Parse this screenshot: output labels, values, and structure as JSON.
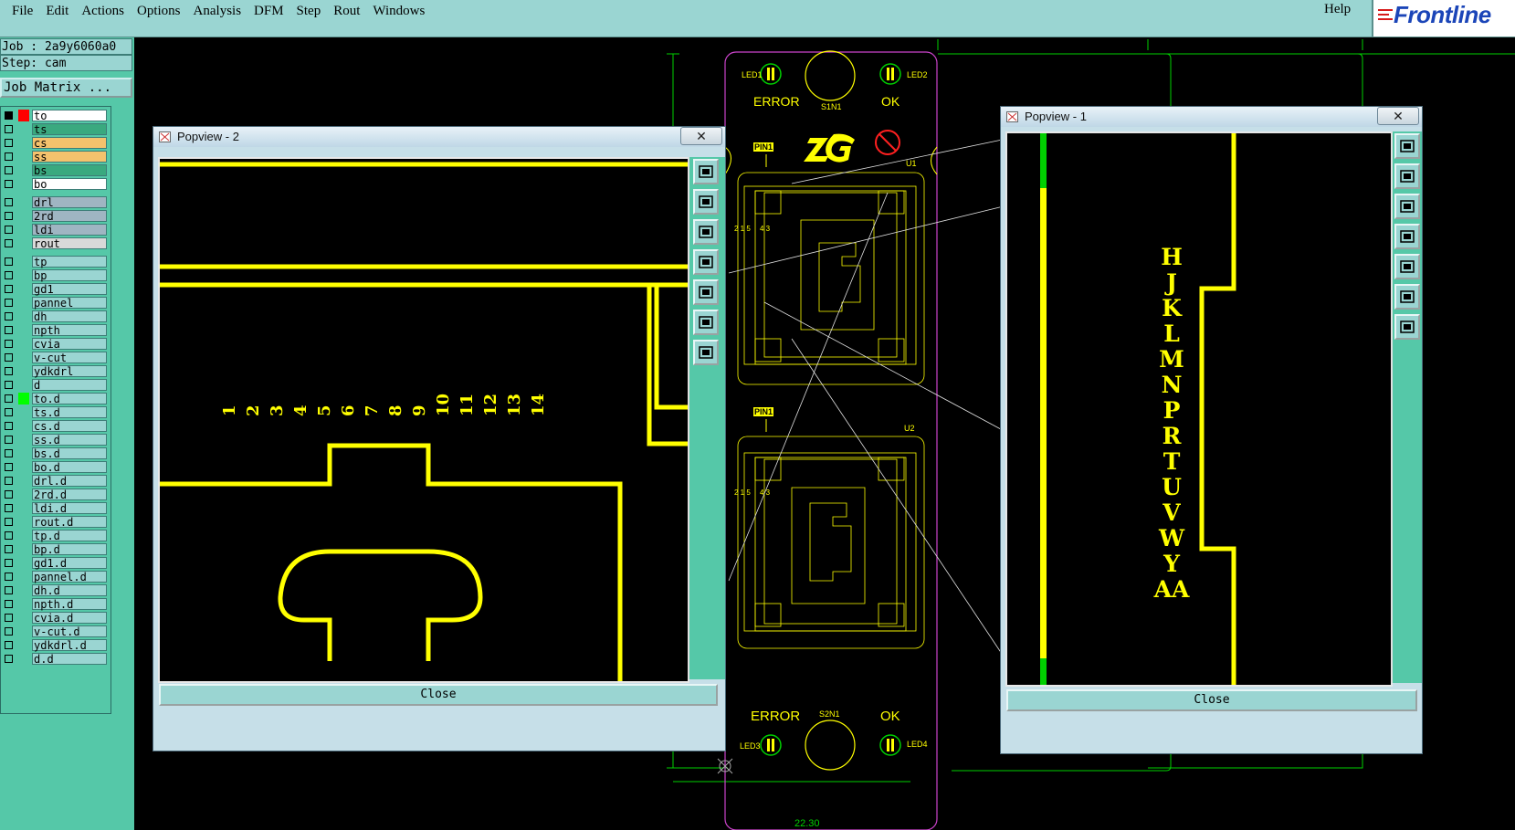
{
  "menu": [
    "File",
    "Edit",
    "Actions",
    "Options",
    "Analysis",
    "DFM",
    "Step",
    "Rout",
    "Windows"
  ],
  "help": "Help",
  "logo": "Frontline",
  "job": {
    "job_label": "Job : 2a9y6060a0",
    "step_label": "Step: cam",
    "matrix_button": "Job Matrix ..."
  },
  "layers": {
    "group1": [
      "to",
      "ts",
      "cs",
      "ss",
      "bs",
      "bo"
    ],
    "group2": [
      "drl",
      "2rd",
      "ldi",
      "rout"
    ],
    "group3": [
      "tp",
      "bp",
      "gd1",
      "pannel",
      "dh",
      "npth",
      "cvia",
      "v-cut",
      "ydkdrl",
      "d",
      "to.d",
      "ts.d",
      "cs.d",
      "ss.d",
      "bs.d",
      "bo.d",
      "drl.d",
      "2rd.d",
      "ldi.d",
      "rout.d",
      "tp.d",
      "bp.d",
      "gd1.d",
      "pannel.d",
      "dh.d",
      "npth.d",
      "cvia.d",
      "v-cut.d",
      "ydkdrl.d",
      "d.d"
    ]
  },
  "popup2": {
    "title": "Popview - 2",
    "close_x": "✕",
    "close_label": "Close",
    "numbers": [
      "1",
      "2",
      "3",
      "4",
      "5",
      "6",
      "7",
      "8",
      "9",
      "10",
      "11",
      "12",
      "13",
      "14"
    ]
  },
  "popup1": {
    "title": "Popview - 1",
    "close_x": "✕",
    "close_label": "Close",
    "letters": [
      "H",
      "J",
      "K",
      "L",
      "M",
      "N",
      "P",
      "R",
      "T",
      "U",
      "V",
      "W",
      "Y",
      "AA"
    ]
  },
  "board": {
    "led1": "LED1",
    "led2": "LED2",
    "led3": "LED3",
    "led4": "LED4",
    "error_top": "ERROR",
    "ok_top": "OK",
    "error_bottom": "ERROR",
    "ok_bottom": "OK",
    "s1n1": "S1N1",
    "s2n1": "S2N1",
    "pin1_a": "PIN1",
    "pin1_b": "PIN1",
    "u1": "U1",
    "u2": "U2",
    "pins_a": "2 1 5",
    "pins_b": "4 3",
    "brand": "ZLG",
    "dim": "22.30"
  },
  "colors": {
    "teal": "#55c8a8",
    "lightteal": "#9ad5d2",
    "yellow": "#ffff00",
    "green": "#00d000",
    "magenta": "#cc44cc"
  }
}
